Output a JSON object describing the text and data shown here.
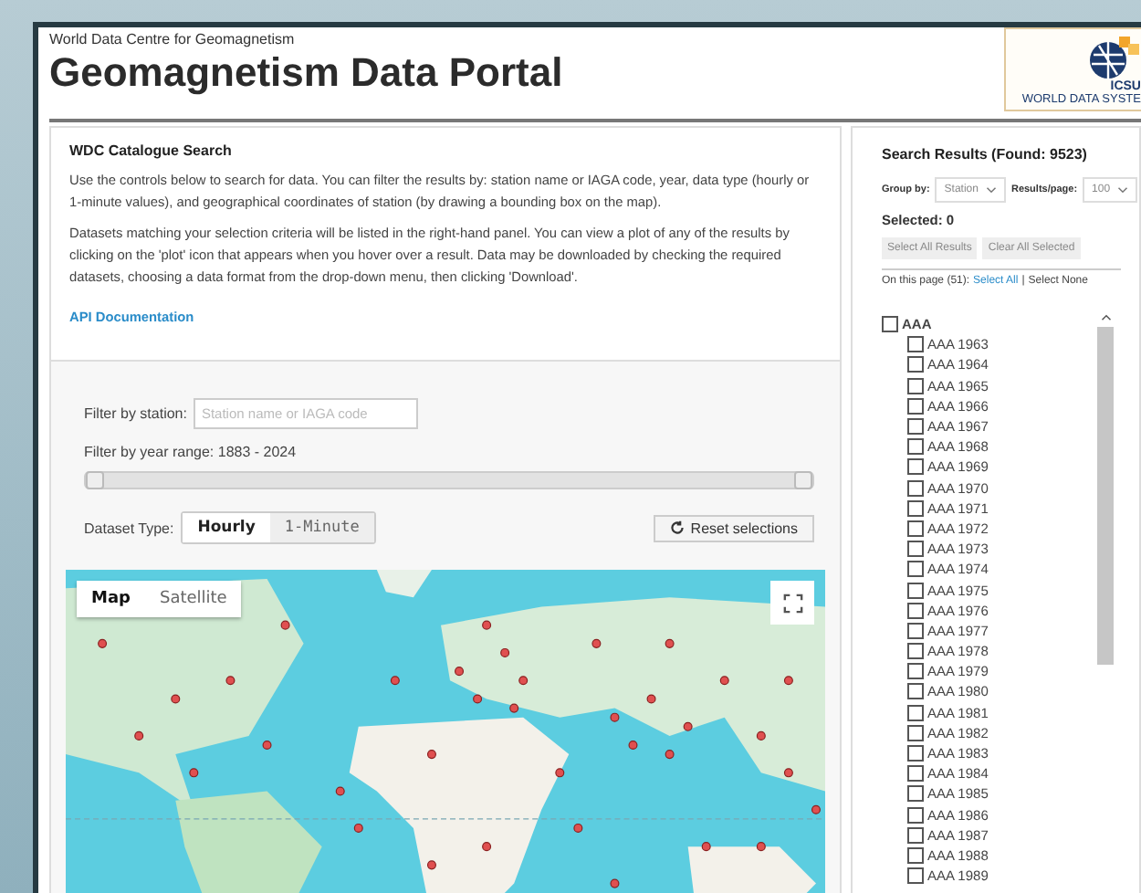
{
  "header": {
    "subtitle": "World Data Centre for Geomagnetism",
    "title": "Geomagnetism Data Portal",
    "logo": {
      "line_1": "ICSU",
      "line_2": "WORLD DATA SYSTE"
    }
  },
  "intro": {
    "heading": "WDC Catalogue Search",
    "paragraphs": [
      "Use the controls below to search for data. You can filter the results by: station name or IAGA code, year, data type (hourly or 1-minute values), and geographical coordinates of station (by drawing a bounding box on the map).",
      "Datasets matching your selection criteria will be listed in the right-hand panel. You can view a plot of any of the results by clicking on the 'plot' icon that appears when you hover over a result. Data may be downloaded by checking the required datasets, choosing a data format from the drop-down menu, then clicking 'Download'."
    ],
    "link": "API Documentation"
  },
  "filters": {
    "station_label": "Filter by station:",
    "station_placeholder": "Station name or IAGA code",
    "year_label": "Filter by year range: 1883 - 2024",
    "year_slider": {
      "handles": [
        {
          "level": 0
        },
        {
          "level": 1
        }
      ]
    },
    "dataset_type_label": "Dataset Type:",
    "dataset_types": [
      {
        "label": "Hourly",
        "selected": true
      },
      {
        "label": "1-Minute",
        "selected": false
      }
    ],
    "reset_button": "Reset selections"
  },
  "map": {
    "modes": [
      {
        "label": "Map",
        "selected": true
      },
      {
        "label": "Satellite",
        "selected": false
      }
    ]
  },
  "results": {
    "title": "Search Results (Found: 9523)",
    "group_by_label": "Group by:",
    "group_by_value": "Station",
    "per_page_label": "Results/page:",
    "per_page_value": "100",
    "selected_count": "Selected: 0",
    "select_all_results": "Select All Results",
    "clear_all_selected": "Clear All Selected",
    "page_info": "On this page (51):",
    "select_all": "Select All",
    "separator": "|",
    "select_none": "Select None",
    "tree": [
      {
        "label": "AAA",
        "checked": false,
        "children": [
          {
            "label": "AAA 1963",
            "checked": false
          },
          {
            "label": "AAA 1964",
            "checked": false
          },
          {
            "label": "AAA 1965",
            "checked": false
          },
          {
            "label": "AAA 1966",
            "checked": false
          },
          {
            "label": "AAA 1967",
            "checked": false
          },
          {
            "label": "AAA 1968",
            "checked": false
          },
          {
            "label": "AAA 1969",
            "checked": false
          },
          {
            "label": "AAA 1970",
            "checked": false
          },
          {
            "label": "AAA 1971",
            "checked": false
          },
          {
            "label": "AAA 1972",
            "checked": false
          },
          {
            "label": "AAA 1973",
            "checked": false
          },
          {
            "label": "AAA 1974",
            "checked": false
          },
          {
            "label": "AAA 1975",
            "checked": false
          },
          {
            "label": "AAA 1976",
            "checked": false
          },
          {
            "label": "AAA 1977",
            "checked": false
          },
          {
            "label": "AAA 1978",
            "checked": false
          },
          {
            "label": "AAA 1979",
            "checked": false
          },
          {
            "label": "AAA 1980",
            "checked": false
          },
          {
            "label": "AAA 1981",
            "checked": false
          },
          {
            "label": "AAA 1982",
            "checked": false
          },
          {
            "label": "AAA 1983",
            "checked": false
          },
          {
            "label": "AAA 1984",
            "checked": false
          },
          {
            "label": "AAA 1985",
            "checked": false
          },
          {
            "label": "AAA 1986",
            "checked": false
          },
          {
            "label": "AAA 1987",
            "checked": false
          },
          {
            "label": "AAA 1988",
            "checked": false
          },
          {
            "label": "AAA 1989",
            "checked": false
          }
        ]
      }
    ]
  }
}
